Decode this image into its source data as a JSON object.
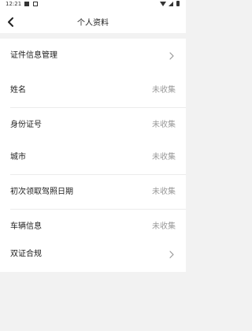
{
  "status_bar": {
    "time": "12:21"
  },
  "header": {
    "title": "个人资料"
  },
  "sections": {
    "cert": {
      "label": "证件信息管理"
    },
    "personal": [
      {
        "label": "姓名",
        "value": "未收集"
      },
      {
        "label": "身份证号",
        "value": "未收集"
      }
    ],
    "driving": [
      {
        "label": "城市",
        "value": "未收集"
      },
      {
        "label": "初次领取驾照日期",
        "value": "未收集"
      },
      {
        "label": "车辆信息",
        "value": "未收集"
      }
    ],
    "compliance": {
      "label": "双证合规"
    }
  },
  "icons": {
    "back": "back-arrow-icon",
    "chevron": "chevron-right-icon"
  }
}
